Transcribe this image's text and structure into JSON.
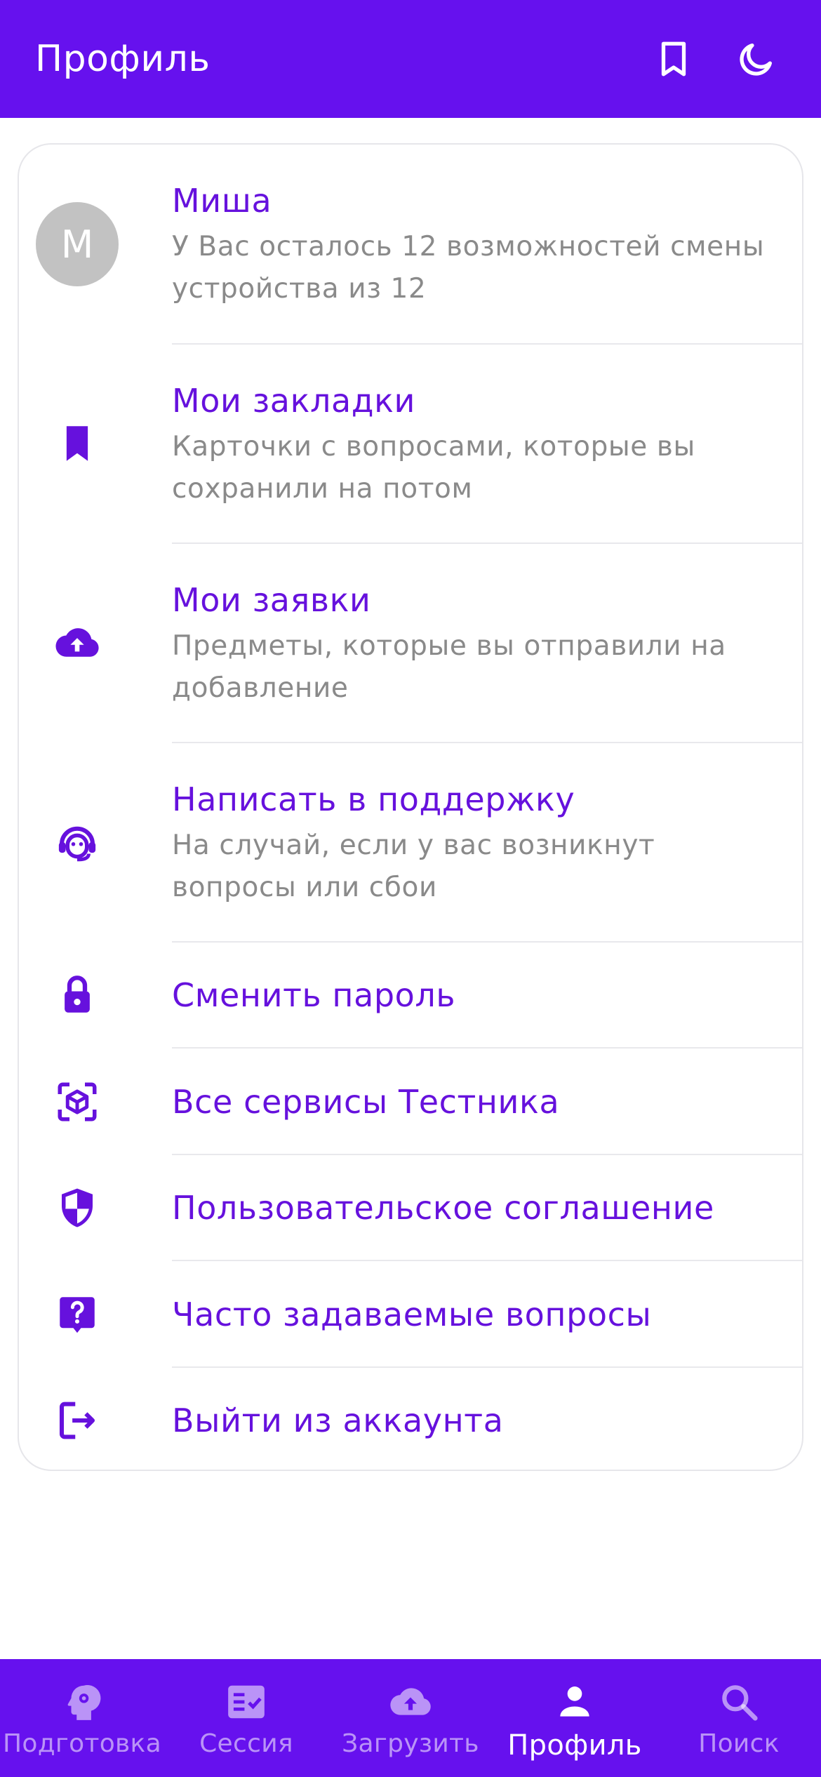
{
  "header": {
    "title": "Профиль",
    "icons": [
      "bookmark-icon",
      "moon-icon"
    ]
  },
  "colors": {
    "primary": "#6611ee",
    "title_text": "#6611dd",
    "subtitle_text": "#8a8a8a",
    "avatar_bg": "#c2c2c2"
  },
  "profile": {
    "avatar_letter": "M",
    "name": "Миша",
    "subtitle": "У Вас осталось 12 возможностей смены устройства из 12"
  },
  "menu": [
    {
      "title": "Мои закладки",
      "subtitle": "Карточки с вопросами, которые вы сохранили на потом",
      "icon": "bookmark-icon"
    },
    {
      "title": "Мои заявки",
      "subtitle": "Предметы, которые вы отправили на добавление",
      "icon": "cloud-upload-icon"
    },
    {
      "title": "Написать в поддержку",
      "subtitle": "На случай, если у вас возникнут вопросы или сбои",
      "icon": "support-agent-icon"
    },
    {
      "title": "Сменить пароль",
      "icon": "lock-icon"
    },
    {
      "title": "Все сервисы Тестника",
      "icon": "view-in-ar-icon"
    },
    {
      "title": "Пользовательское соглашение",
      "icon": "shield-icon"
    },
    {
      "title": "Часто задаваемые вопросы",
      "icon": "question-icon"
    },
    {
      "title": "Выйти из аккаунта",
      "icon": "logout-icon"
    }
  ],
  "bottom_nav": {
    "active": "Профиль",
    "items": [
      {
        "label": "Подготовка",
        "icon": "psychology-icon"
      },
      {
        "label": "Сессия",
        "icon": "fact-check-icon"
      },
      {
        "label": "Загрузить",
        "icon": "cloud-upload-icon"
      },
      {
        "label": "Профиль",
        "icon": "person-icon"
      },
      {
        "label": "Поиск",
        "icon": "search-icon"
      }
    ]
  }
}
